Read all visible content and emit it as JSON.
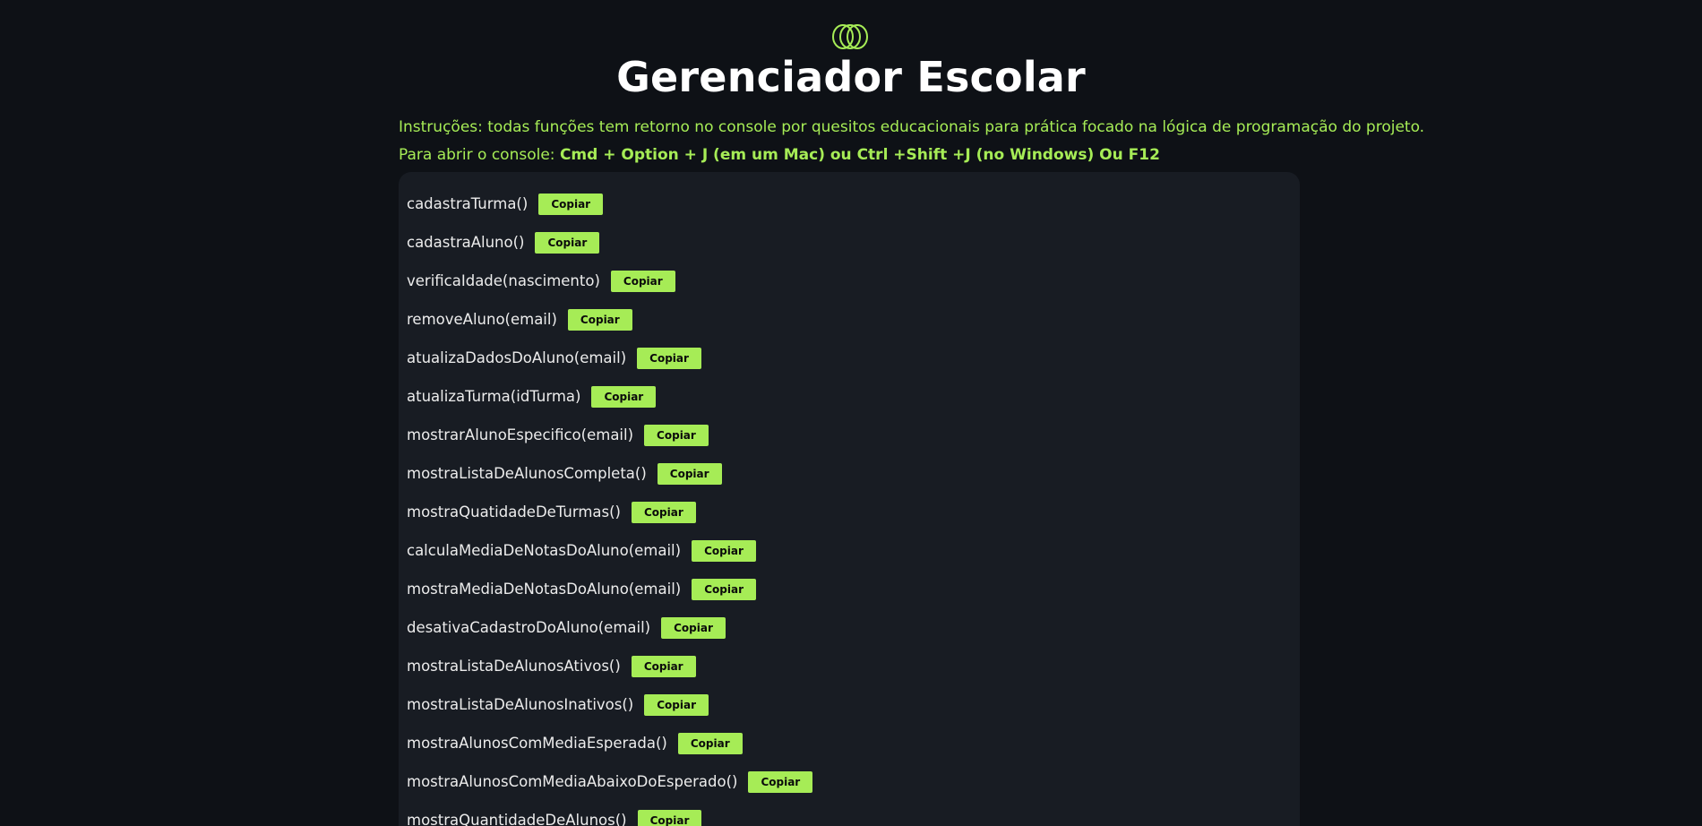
{
  "header": {
    "logo_icon": "interlocking-rings-icon",
    "title": "Gerenciador Escolar"
  },
  "instructions": {
    "text": "Instruções: todas funções tem retorno no console por quesitos educacionais para prática focado na lógica de programação do projeto.",
    "open_console_prefix": "Para abrir o console: ",
    "open_console_keys": "Cmd + Option + J (em um Mac) ou Ctrl +Shift +J (no Windows) Ou F12"
  },
  "colors": {
    "background": "#0e1116",
    "panel": "#181c23",
    "accent": "#a6ec56"
  },
  "functions": [
    {
      "name": "cadastraTurma()",
      "button": "Copiar"
    },
    {
      "name": "cadastraAluno()",
      "button": "Copiar"
    },
    {
      "name": "verificaIdade(nascimento)",
      "button": "Copiar"
    },
    {
      "name": "removeAluno(email)",
      "button": "Copiar"
    },
    {
      "name": "atualizaDadosDoAluno(email)",
      "button": "Copiar"
    },
    {
      "name": "atualizaTurma(idTurma)",
      "button": "Copiar"
    },
    {
      "name": "mostrarAlunoEspecifico(email)",
      "button": "Copiar"
    },
    {
      "name": "mostraListaDeAlunosCompleta()",
      "button": "Copiar"
    },
    {
      "name": "mostraQuatidadeDeTurmas()",
      "button": "Copiar"
    },
    {
      "name": "calculaMediaDeNotasDoAluno(email)",
      "button": "Copiar"
    },
    {
      "name": "mostraMediaDeNotasDoAluno(email)",
      "button": "Copiar"
    },
    {
      "name": "desativaCadastroDoAluno(email)",
      "button": "Copiar"
    },
    {
      "name": "mostraListaDeAlunosAtivos()",
      "button": "Copiar"
    },
    {
      "name": "mostraListaDeAlunosInativos()",
      "button": "Copiar"
    },
    {
      "name": "mostraAlunosComMediaEsperada()",
      "button": "Copiar"
    },
    {
      "name": "mostraAlunosComMediaAbaixoDoEsperado()",
      "button": "Copiar"
    },
    {
      "name": "mostraQuantidadeDeAlunos()",
      "button": "Copiar"
    }
  ]
}
